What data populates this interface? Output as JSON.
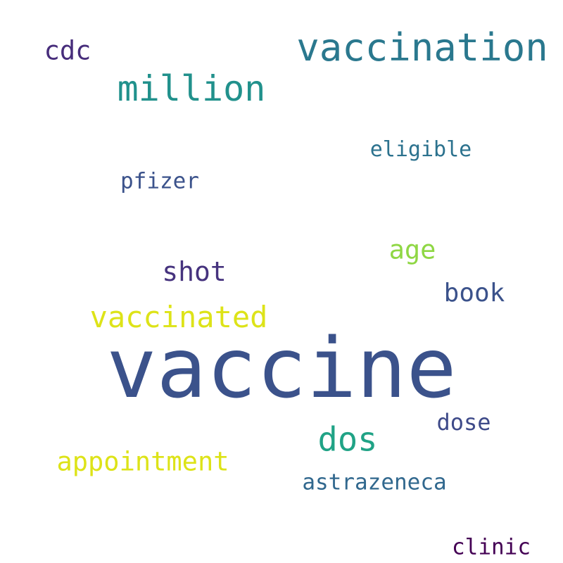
{
  "words": {
    "vaccine": {
      "text": "vaccine",
      "color": "#3b528b"
    },
    "vaccination": {
      "text": "vaccination",
      "color": "#2a788e"
    },
    "million": {
      "text": "million",
      "color": "#21918c"
    },
    "vaccinated": {
      "text": "vaccinated",
      "color": "#dde318"
    },
    "dos": {
      "text": "dos",
      "color": "#20a386"
    },
    "appointment": {
      "text": "appointment",
      "color": "#dde318"
    },
    "shot": {
      "text": "shot",
      "color": "#46337e"
    },
    "cdc": {
      "text": "cdc",
      "color": "#472d7b"
    },
    "age": {
      "text": "age",
      "color": "#8fd744"
    },
    "book": {
      "text": "book",
      "color": "#3b528b"
    },
    "dose": {
      "text": "dose",
      "color": "#3e4a89"
    },
    "astrazeneca": {
      "text": "astrazeneca",
      "color": "#31688e"
    },
    "eligible": {
      "text": "eligible",
      "color": "#2c728e"
    },
    "pfizer": {
      "text": "pfizer",
      "color": "#3b528b"
    },
    "clinic": {
      "text": "clinic",
      "color": "#440154"
    }
  }
}
